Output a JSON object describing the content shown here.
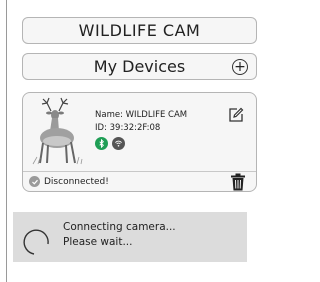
{
  "header": {
    "title": "WILDLIFE CAM"
  },
  "devices": {
    "label": "My Devices",
    "add_symbol": "+"
  },
  "device_card": {
    "name_label": "Name:",
    "name_value": "WILDLIFE CAM",
    "id_label": "ID:",
    "id_value": "39:32:2F:08",
    "icons": [
      "deer-image",
      "bluetooth-icon",
      "wifi-icon",
      "edit-icon",
      "trash-icon",
      "disconnected-icon"
    ],
    "status_text": "Disconnected!",
    "colors": {
      "bluetooth": "#1f9e55",
      "wifi": "#555555",
      "status_dot": "#9a9a9a"
    }
  },
  "toast": {
    "line1": "Connecting camera...",
    "line2": "Please wait..."
  }
}
